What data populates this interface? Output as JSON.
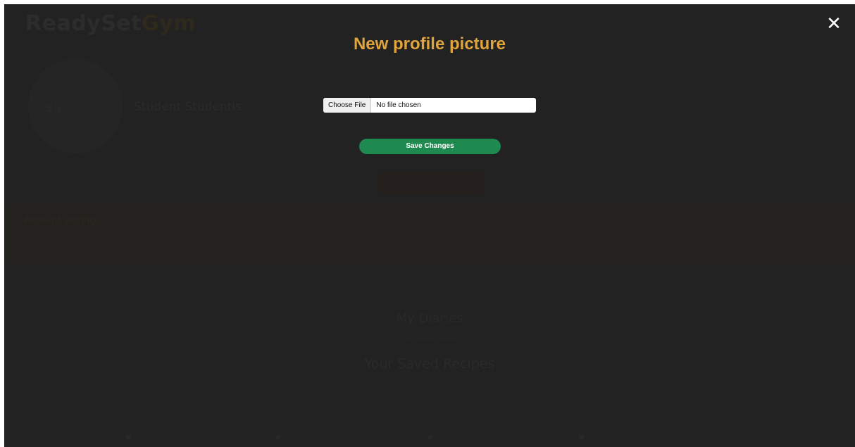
{
  "background_page": {
    "logo_part1": "ReadySet",
    "logo_part2": "Gym",
    "avatar_initials": "SS",
    "username": "Student Studentis",
    "band_title": "Account settings",
    "diaries_title": "My Diaries",
    "diaries_subtitle": "No diaries found",
    "recipes_title": "Your Saved Recipes"
  },
  "modal": {
    "title": "New profile picture",
    "close_icon": "close-icon",
    "file_choose_label": "Choose File",
    "file_status": "No file chosen",
    "save_label": "Save Changes"
  },
  "colors": {
    "title": "#e0a43c",
    "save_button": "#1f8a4f",
    "background": "#2a2a2a"
  }
}
